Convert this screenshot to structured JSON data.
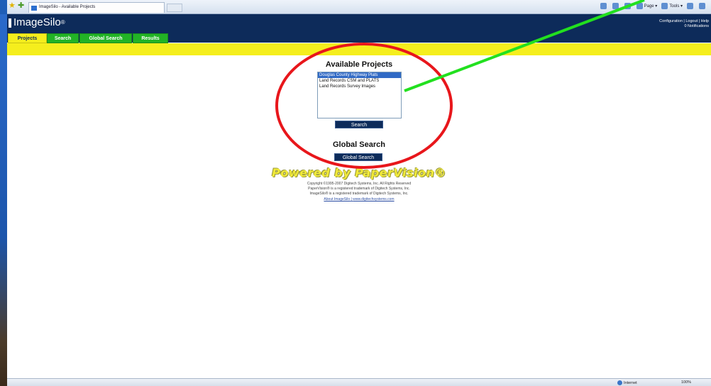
{
  "browser": {
    "tab_title": "ImageSilo - Available Projects",
    "toolbar_items": [
      "Page ▾",
      "Tools ▾"
    ],
    "status_zone": "Internet",
    "status_zoom": "100%"
  },
  "app": {
    "logo": "ImageSilo",
    "logo_mark": "®",
    "header_links": "Configuration | Logout | Help",
    "notifications": "0 Notifications",
    "tabs": [
      {
        "label": "Projects",
        "active": true
      },
      {
        "label": "Search",
        "active": false
      },
      {
        "label": "Global Search",
        "active": false
      },
      {
        "label": "Results",
        "active": false
      }
    ]
  },
  "main": {
    "available_heading": "Available Projects",
    "projects": [
      {
        "name": "Douglas County Highway Plats",
        "selected": true
      },
      {
        "name": "Land Records CSM and PLATS",
        "selected": false
      },
      {
        "name": "Land Records Survey Images",
        "selected": false
      }
    ],
    "search_button": "Search",
    "global_heading": "Global Search",
    "global_button": "Global Search",
    "powered_by": "Powered by PaperVision®",
    "copyright": [
      "Copyright ©1995-2007 Digitech Systems, Inc. All Rights Reserved",
      "PaperVision® is a registered trademark of Digitech Systems, Inc.",
      "ImageSilo® is a registered trademark of Digitech Systems, Inc."
    ],
    "about_link": "About ImageSilo",
    "link_separator": "|",
    "site_link": "www.digitechsystems.com"
  },
  "annotation": {
    "circle_color": "#e8161b",
    "pointer_color": "#22e01f"
  }
}
